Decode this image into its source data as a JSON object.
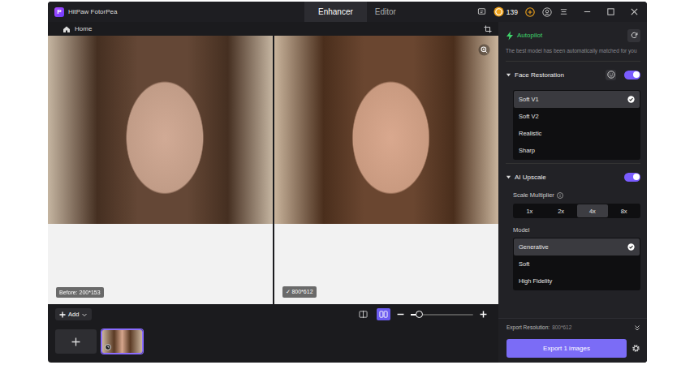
{
  "window": {
    "title": "HitPaw FotorPea",
    "logo": "P"
  },
  "tabs": [
    {
      "label": "Enhancer",
      "selected": true
    },
    {
      "label": "Editor",
      "selected": false
    }
  ],
  "coins": "139",
  "breadcrumb": {
    "label": "Home"
  },
  "preview": {
    "before": {
      "label": "Before: 200*153"
    },
    "after": {
      "mark": "✓",
      "label": "800*612"
    }
  },
  "toolbar": {
    "add_label": "Add",
    "view_modes": [
      {
        "kind": "single",
        "selected": false
      },
      {
        "kind": "split",
        "selected": true
      }
    ],
    "zoom": {
      "level": 0.13
    }
  },
  "thumbnails": [
    {
      "selected": true
    }
  ],
  "panel": {
    "autopilot": {
      "title": "Autopilot",
      "description": "The best model has been automatically matched for you"
    },
    "face_restoration": {
      "title": "Face Restoration",
      "expanded": true,
      "on": true,
      "options": [
        {
          "label": "Soft V1",
          "selected": true
        },
        {
          "label": "Soft V2",
          "selected": false
        },
        {
          "label": "Realistic",
          "selected": false
        },
        {
          "label": "Sharp",
          "selected": false
        }
      ]
    },
    "ai_upscale": {
      "title": "AI Upscale",
      "expanded": true,
      "on": true,
      "scale_label": "Scale Multiplier",
      "scales": [
        {
          "label": "1x",
          "selected": false
        },
        {
          "label": "2x",
          "selected": false
        },
        {
          "label": "4x",
          "selected": true
        },
        {
          "label": "8x",
          "selected": false
        }
      ],
      "model_label": "Model",
      "models": [
        {
          "label": "Generative",
          "selected": true
        },
        {
          "label": "Soft",
          "selected": false
        },
        {
          "label": "High Fidelity",
          "selected": false
        }
      ]
    },
    "export": {
      "label": "Export Resolution:",
      "value": "800*612",
      "button": "Export 1 images"
    }
  }
}
